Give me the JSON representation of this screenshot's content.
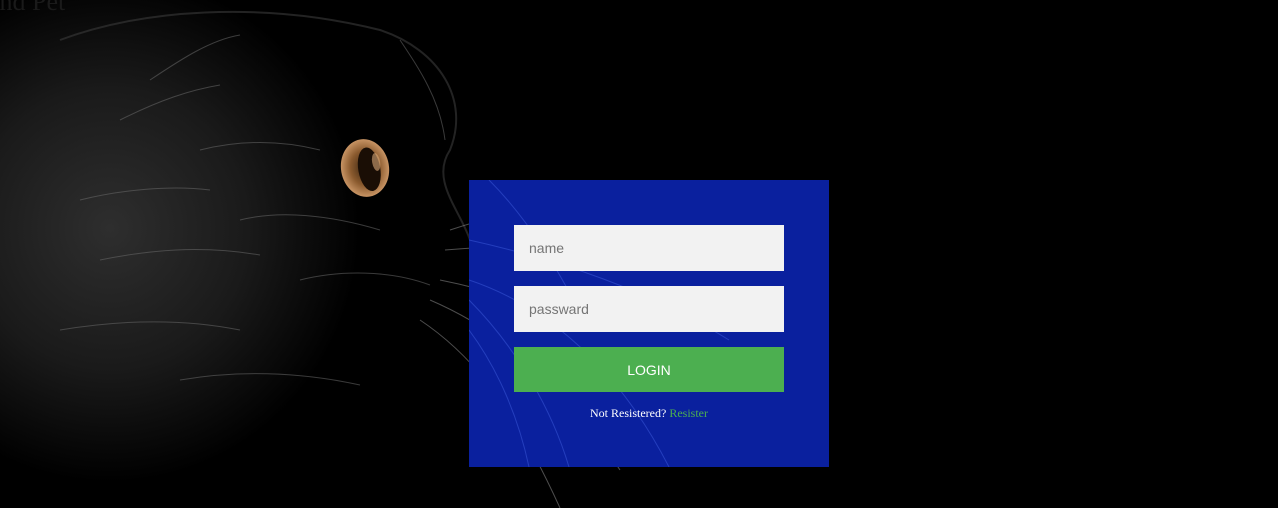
{
  "page": {
    "title": "and  Pet"
  },
  "login": {
    "name_placeholder": "name",
    "password_placeholder": "passward",
    "button_label": "LOGIN",
    "register_prompt": "Not Resistered?",
    "register_link": "Resister"
  },
  "colors": {
    "panel_background": "#0a209e",
    "button_background": "#4caf50",
    "link_color": "#4caf50",
    "field_background": "#f2f2f2",
    "page_background": "#000000"
  },
  "backdrop": {
    "subject": "black-cat-photo"
  }
}
